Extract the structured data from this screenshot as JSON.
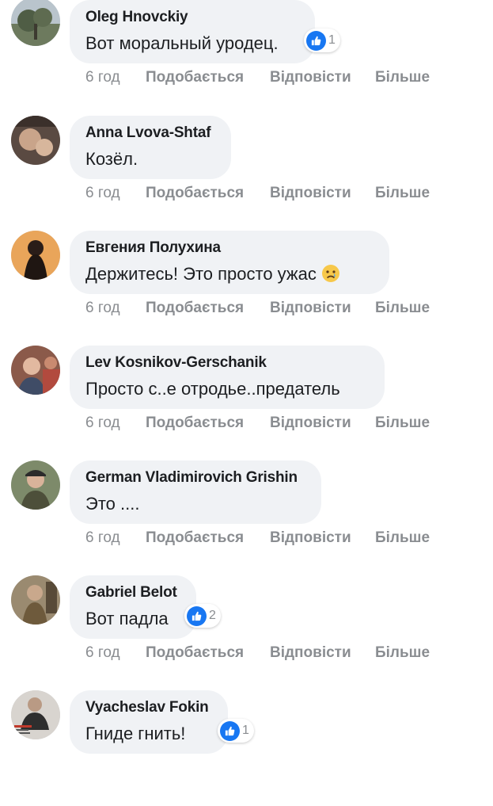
{
  "colors": {
    "bubble_bg": "#f0f2f5",
    "like_blue": "#1877f2",
    "muted": "#8a8d91",
    "text": "#1c1e21"
  },
  "comments": [
    {
      "author": "Oleg Hnovckiy",
      "text": "Вот моральный уродец.",
      "reaction_icon": "like-icon",
      "reaction_count": "1",
      "time": "6 год",
      "like_label": "Подобається",
      "reply_label": "Відповісти",
      "more_label": "Більше"
    },
    {
      "author": "Anna Lvova-Shtaf",
      "text": "Козёл.",
      "time": "6 год",
      "like_label": "Подобається",
      "reply_label": "Відповісти",
      "more_label": "Більше"
    },
    {
      "author": "Евгения Полухина",
      "text": "Держитесь! Это просто ужас",
      "text_emoji": "sad-face-emoji",
      "time": "6 год",
      "like_label": "Подобається",
      "reply_label": "Відповісти",
      "more_label": "Більше"
    },
    {
      "author": "Lev Kosnikov-Gerschanik",
      "text": "Просто с..е отродье..предатель",
      "time": "6 год",
      "like_label": "Подобається",
      "reply_label": "Відповісти",
      "more_label": "Більше"
    },
    {
      "author": "German Vladimirovich Grishin",
      "text": "Это ....",
      "time": "6 год",
      "like_label": "Подобається",
      "reply_label": "Відповісти",
      "more_label": "Більше"
    },
    {
      "author": "Gabriel Belot",
      "text": "Вот падла",
      "reaction_icon": "like-icon",
      "reaction_count": "2",
      "time": "6 год",
      "like_label": "Подобається",
      "reply_label": "Відповісти",
      "more_label": "Більше"
    },
    {
      "author": "Vyacheslav Fokin",
      "text": "Гниде гнить!",
      "reaction_icon": "like-icon",
      "reaction_count": "1"
    }
  ]
}
